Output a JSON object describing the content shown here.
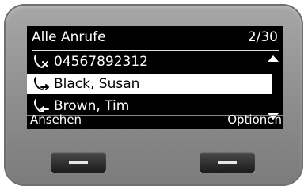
{
  "screen": {
    "title": "Alle Anrufe",
    "page_indicator": "2/30"
  },
  "calls": [
    {
      "label": "04567892312",
      "icon": "missed-call-icon"
    },
    {
      "label": "Black, Susan",
      "icon": "outgoing-call-icon"
    },
    {
      "label": "Brown, Tim",
      "icon": "incoming-call-icon"
    }
  ],
  "softkeys": {
    "left": "Ansehen",
    "right": "Optionen"
  },
  "colors": {
    "screen_bg": "#000000",
    "text": "#ffffff",
    "highlight_bg": "#ffffff",
    "highlight_text": "#000000",
    "bezel": "#8d8d8d"
  }
}
